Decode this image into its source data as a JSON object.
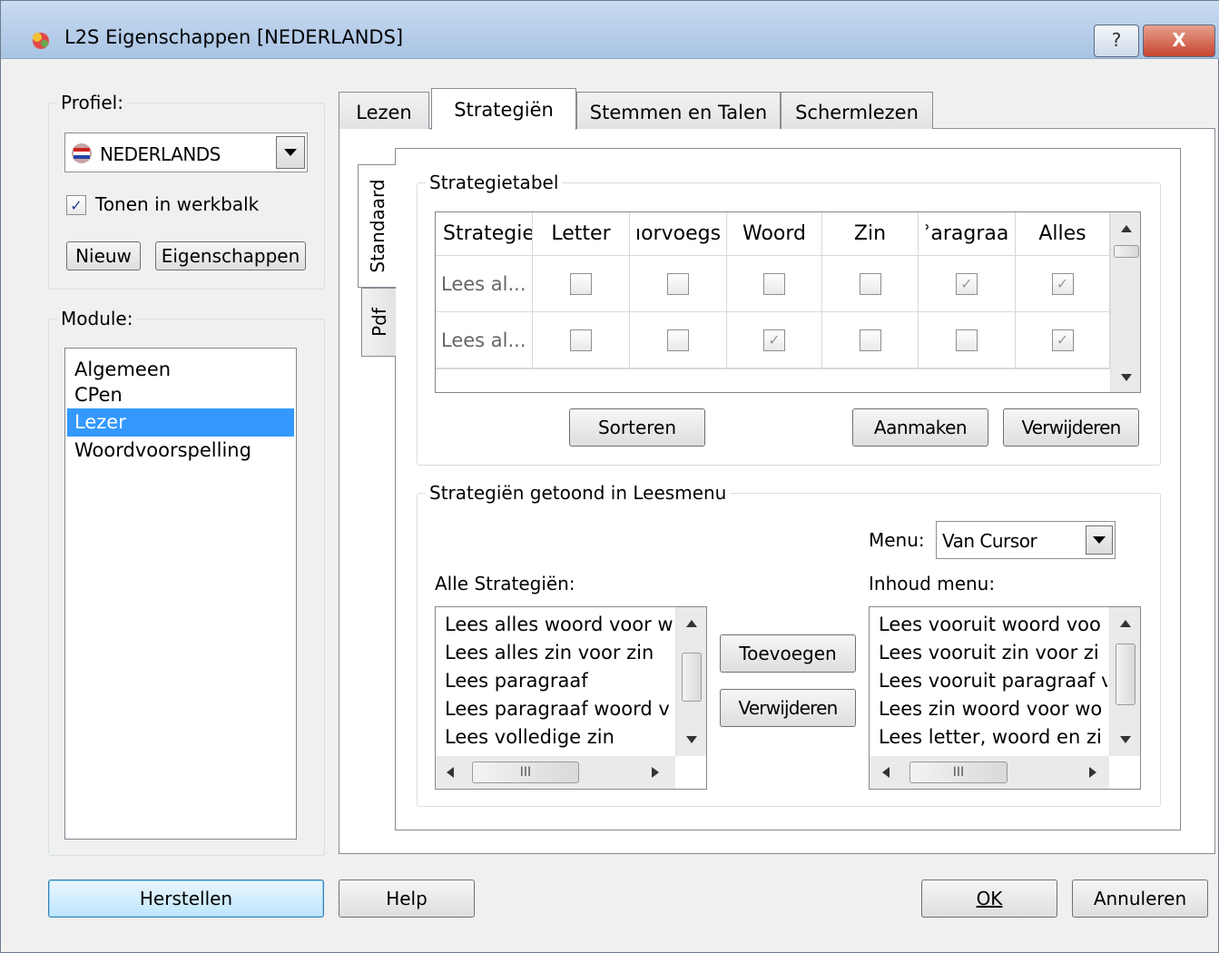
{
  "window": {
    "title": "L2S Eigenschappen [NEDERLANDS]",
    "help_glyph": "?",
    "close_glyph": "X"
  },
  "profile": {
    "group_label": "Profiel:",
    "selected": "NEDERLANDS",
    "show_in_toolbar_label": "Tonen in werkbalk",
    "show_in_toolbar_checked": true,
    "new_button": "Nieuw",
    "properties_button": "Eigenschappen"
  },
  "module": {
    "group_label": "Module:",
    "items": [
      "Algemeen",
      "CPen",
      "Lezer",
      "Woordvoorspelling"
    ],
    "selected_index": 2
  },
  "tabs": [
    {
      "label": "Lezen",
      "active": false
    },
    {
      "label": "Strategiën",
      "active": true
    },
    {
      "label": "Stemmen en Talen",
      "active": false
    },
    {
      "label": "Schermlezen",
      "active": false
    }
  ],
  "vertical_tabs": [
    {
      "label": "Standaard",
      "active": true
    },
    {
      "label": "Pdf",
      "active": false
    }
  ],
  "strategy_table": {
    "group_label": "Strategietabel",
    "columns": [
      "Strategie",
      "Letter",
      "ıorvoegs",
      "Woord",
      "Zin",
      "ʾaragraa",
      "Alles"
    ],
    "rows": [
      {
        "label": "Lees al...",
        "checks": [
          false,
          false,
          false,
          false,
          true,
          true
        ]
      },
      {
        "label": "Lees al...",
        "checks": [
          false,
          false,
          true,
          false,
          false,
          true
        ]
      }
    ],
    "check_glyph": "✓",
    "buttons": {
      "sort": "Sorteren",
      "create": "Aanmaken",
      "delete": "Verwijderen"
    }
  },
  "read_menu": {
    "group_label": "Strategiën getoond in Leesmenu",
    "menu_label": "Menu:",
    "menu_value": "Van Cursor",
    "all_label": "Alle Strategiën:",
    "content_label": "Inhoud menu:",
    "all_items": [
      "Lees alles woord voor w",
      "Lees alles zin voor zin",
      "Lees paragraaf",
      "Lees paragraaf woord v",
      "Lees volledige zin"
    ],
    "content_items": [
      "Lees vooruit woord voo",
      "Lees vooruit zin voor zi",
      "Lees vooruit paragraaf v",
      "Lees zin woord voor wo",
      "Lees letter, woord en zi"
    ],
    "add_button": "Toevoegen",
    "remove_button": "Verwijderen",
    "hscroll_glyph": "III"
  },
  "footer": {
    "restore_button": "Herstellen",
    "help_button": "Help",
    "ok_button": "OK",
    "cancel_button": "Annuleren"
  }
}
